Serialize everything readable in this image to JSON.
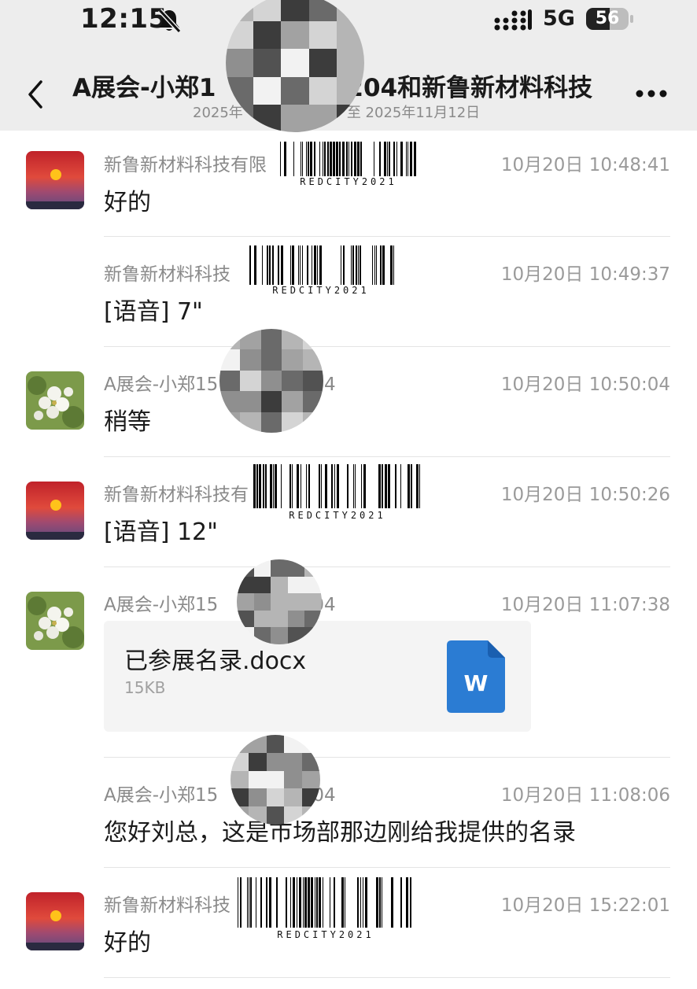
{
  "status_bar": {
    "time": "12:15",
    "network": "5G",
    "battery": 56,
    "battery_label": "56"
  },
  "header": {
    "title": "A展会-小郑1",
    "title_rest": "204和新鲁新材料科技",
    "subtitle_left": "2025年",
    "subtitle_right": "至 2025年11月12日"
  },
  "messages": [
    {
      "sender": "新鲁新材料科技有限",
      "time": "10月20日 10:48:41",
      "text": "好的"
    },
    {
      "sender": "新鲁新材料科技",
      "time": "10月20日 10:49:37",
      "text": "[语音] 7\""
    },
    {
      "sender": "A展会-小郑15",
      "sender_tail": "04",
      "time": "10月20日 10:50:04",
      "text": "稍等"
    },
    {
      "sender": "新鲁新材料科技有",
      "time": "10月20日 10:50:26",
      "text": "[语音] 12\""
    },
    {
      "sender": "A展会-小郑15",
      "sender_tail": "04",
      "time": "10月20日 11:07:38",
      "file": {
        "name": "已参展名录.docx",
        "size": "15KB",
        "icon_letter": "W"
      }
    },
    {
      "sender": "A展会-小郑15",
      "sender_tail": "04",
      "time": "10月20日 11:08:06",
      "text": "您好刘总，这是市场部那边刚给我提供的名录"
    },
    {
      "sender": "新鲁新材料科技",
      "time": "10月20日 15:22:01",
      "text": "好的"
    }
  ],
  "watermark": {
    "barcode_text": "REDCITY2021"
  },
  "colors": {
    "header_bg": "#ededed",
    "word_icon": "#2b7cd3",
    "separator": "#e4e4e4"
  }
}
